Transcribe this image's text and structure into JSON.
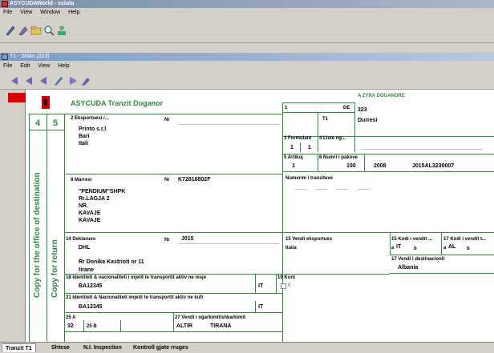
{
  "app": {
    "title": "ASYCUDAWorld - cciuta",
    "menu": [
      "File",
      "View",
      "Window",
      "Help"
    ]
  },
  "document_window": {
    "title": "T1 - Shiko [323]",
    "menu": [
      "File",
      "Edit",
      "View",
      "Help"
    ]
  },
  "form": {
    "header": "ASYCUDA Tranzit Doganor",
    "copy_numbers": [
      "4",
      "5"
    ],
    "copy_destination": "Copy for the office of destination",
    "copy_return": "Copy for return",
    "box1": {
      "label": "1",
      "de_label": "DE",
      "value": "T1"
    },
    "office": {
      "label": "A ZYRA DOGANORE",
      "code": "323",
      "name": "Durresi"
    },
    "exporter": {
      "label": "2 Eksportuesi /...",
      "nr_label": "Nr",
      "lines": [
        "Printo s.r.l",
        "Bari",
        "Itali"
      ]
    },
    "formulare": {
      "label": "3 Formulare",
      "values": [
        "1",
        "1"
      ]
    },
    "liste": {
      "label": "4 Liste ng..."
    },
    "artikuj": {
      "label": "5 Artikuj",
      "value": "1"
    },
    "pakove": {
      "label": "6 Numri i pakove",
      "value": "100",
      "year": "2008",
      "ref": "J015AL3230007"
    },
    "consignee": {
      "label": "8 Marresi",
      "nr_label": "Nr",
      "nr_value": "K72816802F",
      "lines": [
        "\"PENDIUM\"SHPK",
        "Rr.LAGJA 2",
        "NR.",
        "KAVAJE",
        "KAVAJE"
      ]
    },
    "transit_numbers": {
      "label": "Numerim i tranziteve"
    },
    "declarant": {
      "label": "14 Deklarues",
      "nr_label": "Nr",
      "nr_value": "J015",
      "lines": [
        "DHL",
        "",
        "Rr Donika Kastrioti nr 11",
        "tirane"
      ]
    },
    "export_country": {
      "label": "15 Vendi eksportues",
      "value": "Italia"
    },
    "code15": {
      "label": "15 Kodi i vendit ...",
      "a": "IT",
      "b_label": "b"
    },
    "code17": {
      "label": "17 Kodi i vendit t...",
      "a": "AL",
      "b_label": "b"
    },
    "dest_country": {
      "label": "17 Vendi i destinacionit",
      "value": "Albania"
    },
    "box18": {
      "label": "18 Identiteti & nacionaliteti i mjetit te transportit aktiv ne nisje",
      "value": "BA12345",
      "country": "IT"
    },
    "box19": {
      "label": "19 Kont",
      "value": "0"
    },
    "box21": {
      "label": "21 Identiteti & Nacionaliteti imjetit te transportit aktiv ne kufi",
      "value": "BA12345",
      "country": "IT"
    },
    "box25": {
      "label": "25 A",
      "value": "32",
      "sub": "25 B"
    },
    "box27": {
      "label": "27 Vendi i ngarkimit/shkarkimit",
      "code": "ALTIR",
      "name": "TIRANA"
    }
  },
  "bottom_tabs": [
    "Tranzit T1",
    "Shtese",
    "N.I. Inspection",
    "Kontroll gjate rruges"
  ],
  "colors": {
    "form_green": "#2f8a3f",
    "accent_red": "#dd0000"
  }
}
